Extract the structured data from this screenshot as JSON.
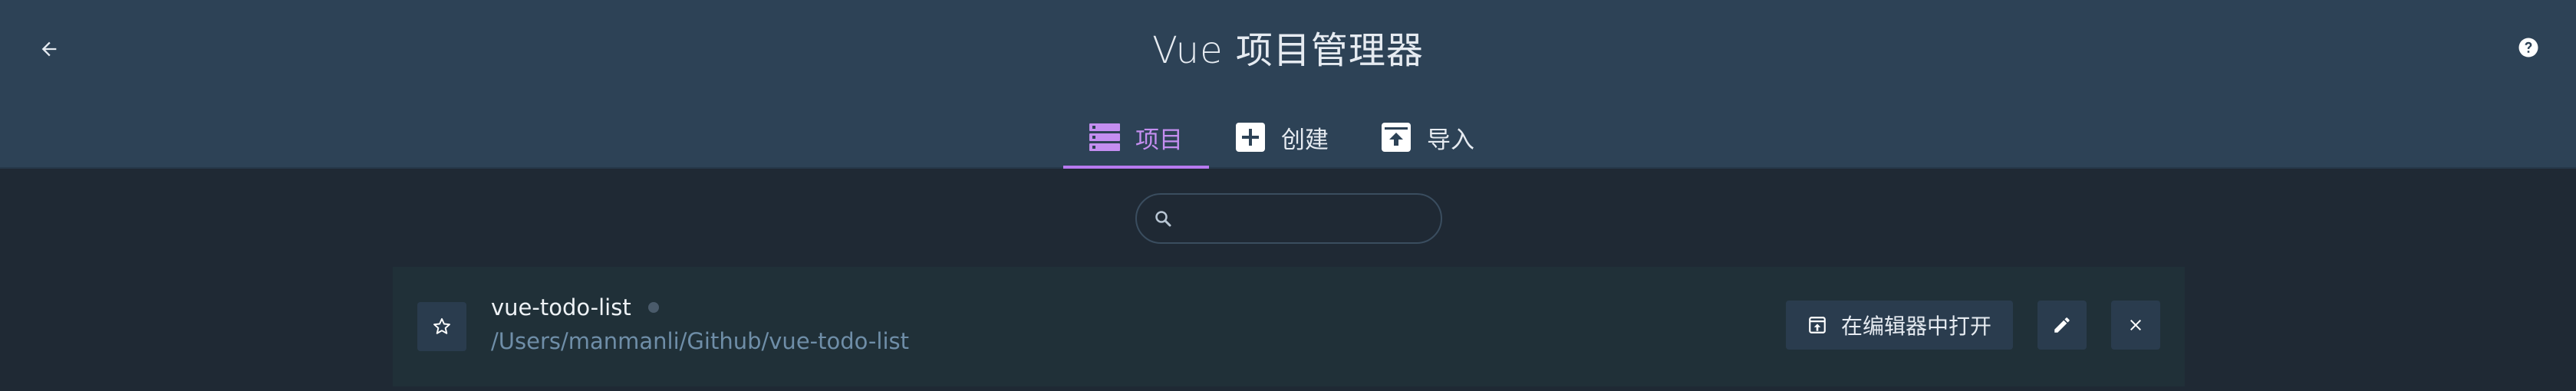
{
  "header": {
    "title": "Vue 项目管理器",
    "back_icon": "arrow-left-icon",
    "help_icon": "help-circle-icon"
  },
  "tabs": [
    {
      "label": "项目",
      "icon": "projects-list-icon",
      "active": true
    },
    {
      "label": "创建",
      "icon": "add-box-icon",
      "active": false
    },
    {
      "label": "导入",
      "icon": "import-unarchive-icon",
      "active": false
    }
  ],
  "search": {
    "value": "",
    "placeholder": "",
    "icon": "search-icon"
  },
  "projects": [
    {
      "name": "vue-todo-list",
      "path": "/Users/manmanli/Github/vue-todo-list",
      "favorite": false,
      "open_in_editor_label": "在编辑器中打开"
    }
  ],
  "colors": {
    "header_bg": "#2d4256",
    "page_bg": "#1f2934",
    "accent": "#b77af0",
    "card_bg": "#203038",
    "button_bg": "#2a3c4e",
    "path_text": "#6f8ea8"
  }
}
